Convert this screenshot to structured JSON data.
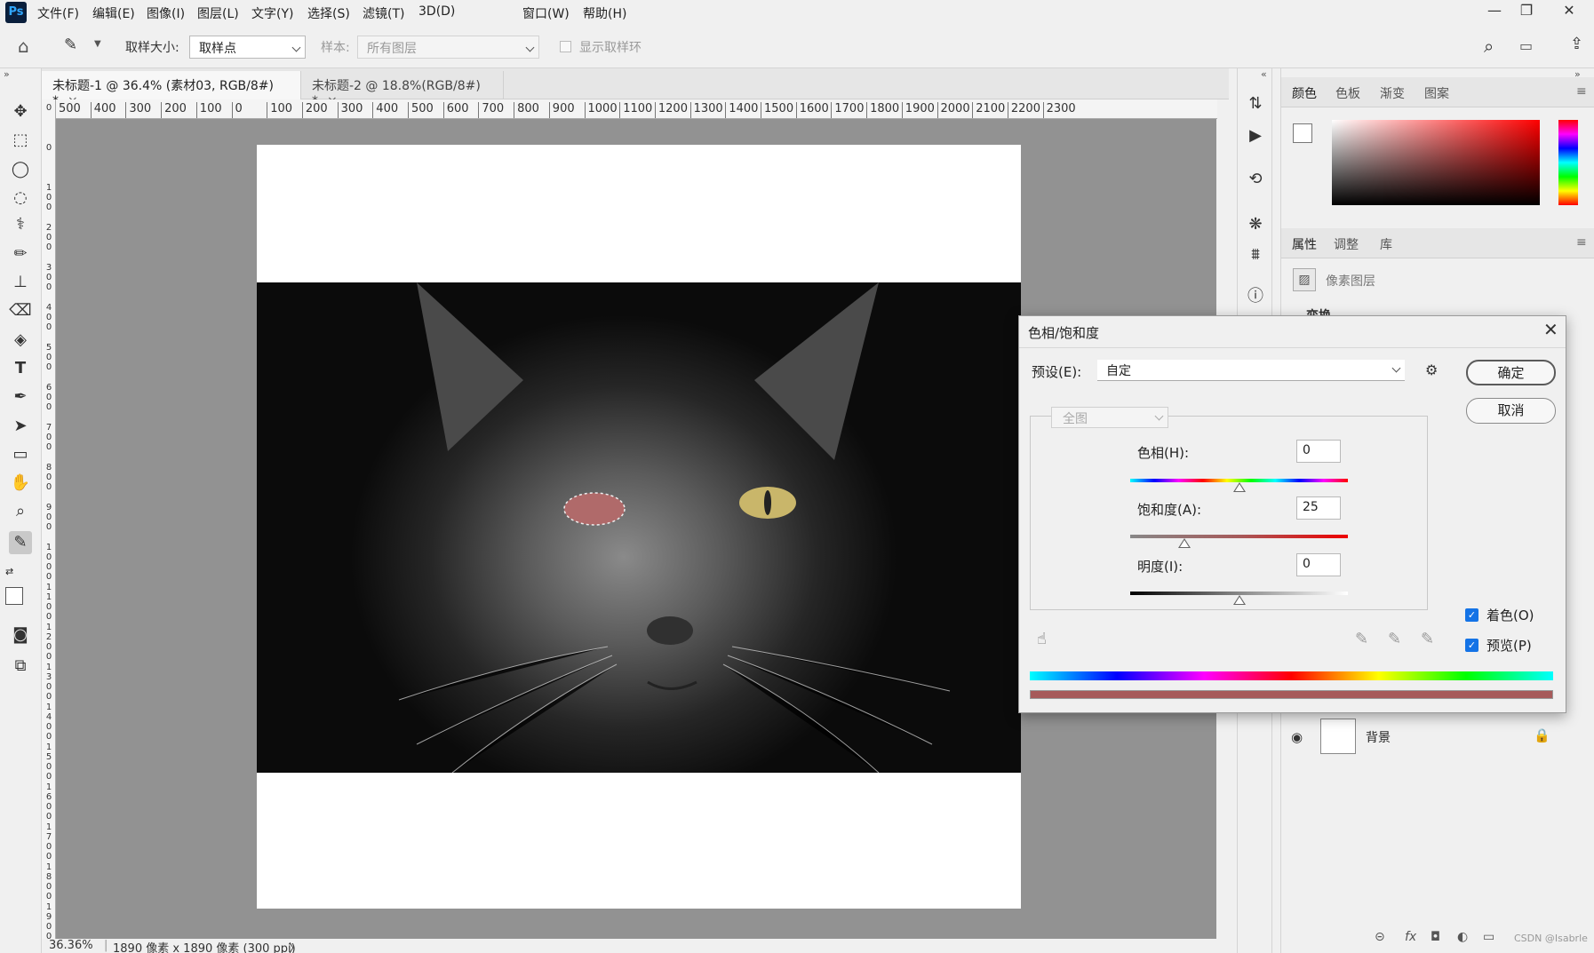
{
  "app": {
    "logo": "Ps"
  },
  "menu": [
    "文件(F)",
    "编辑(E)",
    "图像(I)",
    "图层(L)",
    "文字(Y)",
    "选择(S)",
    "滤镜(T)",
    "3D(D)",
    "窗口(W)",
    "帮助(H)"
  ],
  "window_controls": {
    "minimize": "—",
    "restore": "❐",
    "close": "✕"
  },
  "options": {
    "sample_size_label": "取样大小:",
    "sample_size_value": "取样点",
    "sample_label": "样本:",
    "sample_value": "所有图层",
    "show_ring_label": "显示取样环"
  },
  "tabs": [
    {
      "label": "未标题-1 @ 36.4% (素材03, RGB/8#) *",
      "close": "×"
    },
    {
      "label": "未标题-2 @ 18.8%(RGB/8#) *",
      "close": "×"
    }
  ],
  "ruler_h": [
    "500",
    "400",
    "300",
    "200",
    "100",
    "0",
    "100",
    "200",
    "300",
    "400",
    "500",
    "600",
    "700",
    "800",
    "900",
    "1000",
    "1100",
    "1200",
    "1300",
    "1400",
    "1500",
    "1600",
    "1700",
    "1800",
    "1900",
    "2000",
    "2100",
    "2200",
    "2300"
  ],
  "ruler_v": [
    "0",
    "0",
    "100",
    "200",
    "300",
    "400",
    "500",
    "600",
    "700",
    "800",
    "900",
    "1000",
    "1100",
    "1200",
    "1300",
    "1400",
    "1500",
    "1600",
    "1700",
    "1800",
    "1900"
  ],
  "status": {
    "zoom": "36.36%",
    "doc_info": "1890 像素 x 1890 像素 (300 ppi)",
    "arrow": "〉"
  },
  "panels": {
    "color_tabs": [
      "颜色",
      "色板",
      "渐变",
      "图案"
    ],
    "properties_tabs": [
      "属性",
      "调整",
      "库"
    ],
    "pixel_layer_label": "像素图层",
    "transform_label": "变换",
    "layer_name": "背景",
    "bottom_icons": [
      "⊝",
      "fx",
      "◘",
      "◐",
      "▭"
    ],
    "watermark": "CSDN @Isabrle"
  },
  "dialog": {
    "title": "色相/饱和度",
    "preset_label": "预设(E):",
    "preset_value": "自定",
    "channel_value": "全图",
    "hue_label": "色相(H):",
    "hue_value": "0",
    "saturation_label": "饱和度(A):",
    "saturation_value": "25",
    "lightness_label": "明度(I):",
    "lightness_value": "0",
    "ok_label": "确定",
    "cancel_label": "取消",
    "colorize_label": "着色(O)",
    "preview_label": "预览(P)",
    "colorize_checked": true,
    "preview_checked": true,
    "hue_slider": {
      "min": -180,
      "max": 180,
      "value": 0
    },
    "saturation_slider": {
      "min": 0,
      "max": 100,
      "value": 25
    },
    "lightness_slider": {
      "min": -100,
      "max": 100,
      "value": 0
    },
    "colorize_color": "#a65a5a"
  }
}
